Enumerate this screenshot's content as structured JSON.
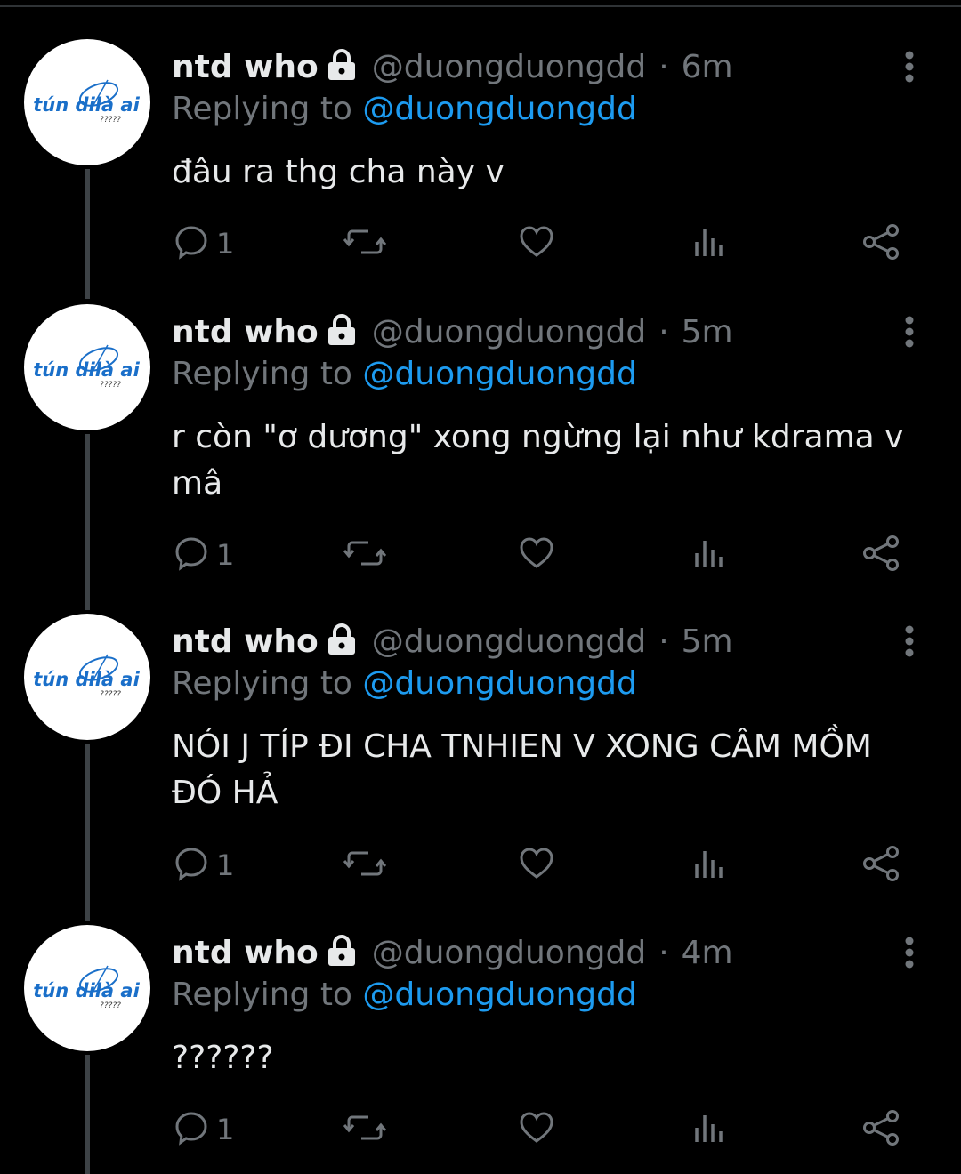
{
  "colors": {
    "background": "#000000",
    "text_primary": "#e7e9ea",
    "text_secondary": "#71767b",
    "link": "#1d9bf0",
    "thread_line": "#3d4246"
  },
  "avatar_logo": {
    "main": "tún dilà ai",
    "sub": "?????"
  },
  "tweets": [
    {
      "name": "ntd who",
      "handle": "@duongduongdd",
      "dot": "·",
      "time": "6m",
      "replying_prefix": "Replying to",
      "replying_to": "@duongduongdd",
      "text": "đâu ra thg cha này v",
      "reply_count": "1",
      "icons": [
        "lock-icon",
        "more-icon",
        "reply-icon",
        "retweet-icon",
        "like-icon",
        "views-icon",
        "share-icon"
      ]
    },
    {
      "name": "ntd who",
      "handle": "@duongduongdd",
      "dot": "·",
      "time": "5m",
      "replying_prefix": "Replying to",
      "replying_to": "@duongduongdd",
      "text": "r còn \"ơ dương\" xong ngừng lại như kdrama v mâ",
      "reply_count": "1",
      "icons": [
        "lock-icon",
        "more-icon",
        "reply-icon",
        "retweet-icon",
        "like-icon",
        "views-icon",
        "share-icon"
      ]
    },
    {
      "name": "ntd who",
      "handle": "@duongduongdd",
      "dot": "·",
      "time": "5m",
      "replying_prefix": "Replying to",
      "replying_to": "@duongduongdd",
      "text": "NÓI J TÍP ĐI CHA TNHIEN V XONG CÂM MỒM ĐÓ HẢ",
      "reply_count": "1",
      "icons": [
        "lock-icon",
        "more-icon",
        "reply-icon",
        "retweet-icon",
        "like-icon",
        "views-icon",
        "share-icon"
      ]
    },
    {
      "name": "ntd who",
      "handle": "@duongduongdd",
      "dot": "·",
      "time": "4m",
      "replying_prefix": "Replying to",
      "replying_to": "@duongduongdd",
      "text": "??????",
      "reply_count": "1",
      "icons": [
        "lock-icon",
        "more-icon",
        "reply-icon",
        "retweet-icon",
        "like-icon",
        "views-icon",
        "share-icon"
      ]
    }
  ]
}
